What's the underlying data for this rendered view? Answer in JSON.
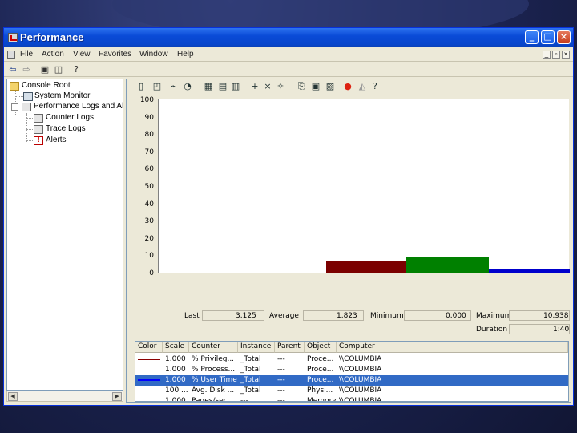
{
  "window": {
    "title": "Performance"
  },
  "menu": [
    "File",
    "Action",
    "View",
    "Favorites",
    "Window",
    "Help"
  ],
  "tree": {
    "items": [
      {
        "label": "Console Root"
      },
      {
        "label": "System Monitor"
      },
      {
        "label": "Performance Logs and Ale"
      },
      {
        "label": "Counter Logs"
      },
      {
        "label": "Trace Logs"
      },
      {
        "label": "Alerts"
      }
    ]
  },
  "chart_data": {
    "type": "bar",
    "yticks": [
      "100",
      "90",
      "80",
      "70",
      "60",
      "50",
      "40",
      "30",
      "20",
      "10",
      "0"
    ],
    "ylim": [
      0,
      100
    ],
    "bars": [
      {
        "color": "#7b0000",
        "value": 7.0,
        "x_frac_start": 0.408,
        "x_frac_end": 0.603
      },
      {
        "color": "#008000",
        "value": 9.7,
        "x_frac_start": 0.603,
        "x_frac_end": 0.803
      },
      {
        "color": "#0000cc",
        "value": 2.5,
        "x_frac_start": 0.803,
        "x_frac_end": 1.0
      }
    ]
  },
  "stats": {
    "last_label": "Last",
    "last_value": "3.125",
    "avg_label": "Average",
    "avg_value": "1.823",
    "min_label": "Minimum",
    "min_value": "0.000",
    "max_label": "Maximum",
    "max_value": "10.938",
    "dur_label": "Duration",
    "dur_value": "1:40"
  },
  "table": {
    "headers": [
      "Color",
      "Scale",
      "Counter",
      "Instance",
      "Parent",
      "Object",
      "Computer"
    ],
    "rows": [
      {
        "color": "#8b0000",
        "scale": "1.000",
        "counter": "% Privileg...",
        "instance": "_Total",
        "parent": "---",
        "object": "Proce...",
        "computer": "\\\\COLUMBIA"
      },
      {
        "color": "#008000",
        "scale": "1.000",
        "counter": "% Process...",
        "instance": "_Total",
        "parent": "---",
        "object": "Proce...",
        "computer": "\\\\COLUMBIA"
      },
      {
        "color": "#0000ff",
        "scale": "1.000",
        "counter": "% User Time",
        "instance": "_Total",
        "parent": "---",
        "object": "Proce...",
        "computer": "\\\\COLUMBIA"
      },
      {
        "color": "#000080",
        "scale": "100....",
        "counter": "Avg. Disk ...",
        "instance": "_Total",
        "parent": "---",
        "object": "Physi...",
        "computer": "\\\\COLUMBIA"
      },
      {
        "color": "#800000",
        "scale": "1.000",
        "counter": "Pages/sec",
        "instance": "---",
        "parent": "---",
        "object": "Memory",
        "computer": "\\\\COLUMBIA"
      }
    ]
  }
}
